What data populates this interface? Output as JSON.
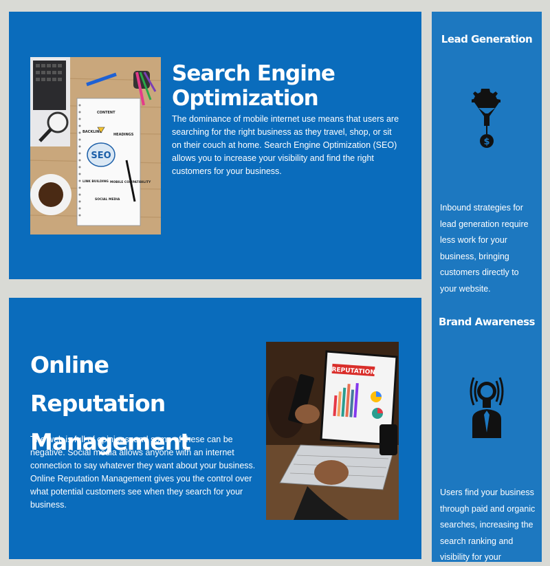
{
  "seo": {
    "title": "Search Engine Optimization",
    "text": "The dominance of mobile internet use means that users are searching for the right business as they travel, shop, or sit on their couch at home. Search Engine Optimization (SEO) allows you to increase your visibility and find the right customers for your business.",
    "image_words": [
      "CONTENT",
      "BACKLINK",
      "HEADINGS",
      "SEO",
      "LINK BUILDING",
      "MOBILE COMPATIBILITY",
      "SOCIAL MEDIA"
    ]
  },
  "orm": {
    "title": "Online Reputation Management",
    "text": "The web is full of opinions, and some of these can be negative. Social media allows anyone with an internet connection to say whatever they want about your business. Online Reputation Management gives you the control over what potential customers see when they search for your business.",
    "image_word": "REPUTATION"
  },
  "sidebar": {
    "lead": {
      "heading": "Lead Generation",
      "text": "Inbound strategies for lead generation require less work for your business, bringing customers directly to your website.",
      "icon": "funnel-gear-dollar-icon"
    },
    "brand": {
      "heading": "Brand Awareness",
      "text": "Users find your business through paid and organic searches, increasing the search ranking and visibility for your",
      "icon": "lightbulb-person-icon"
    }
  },
  "colors": {
    "panel": "#0a6cbc",
    "sidebar": "#1d78c0",
    "background": "#d9dad5"
  }
}
